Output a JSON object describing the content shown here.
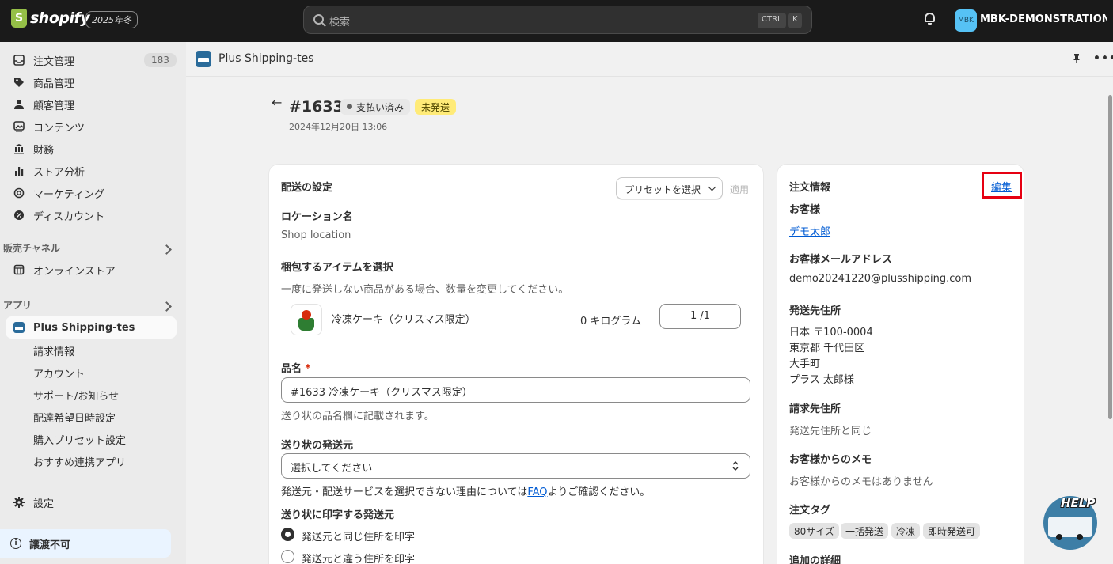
{
  "topbar": {
    "logo_text": "shopify",
    "edition": "2025年冬",
    "search_placeholder": "検索",
    "kbd_ctrl": "CTRL",
    "kbd_k": "K",
    "avatar_initials": "MBK",
    "store_name": "MBK-DEMONSTRATION-..."
  },
  "sidebar": {
    "items": [
      {
        "label": "注文管理",
        "icon": "inbox-icon"
      },
      {
        "label": "商品管理",
        "icon": "tag-icon"
      },
      {
        "label": "顧客管理",
        "icon": "person-icon"
      },
      {
        "label": "コンテンツ",
        "icon": "image-icon"
      },
      {
        "label": "財務",
        "icon": "bank-icon"
      },
      {
        "label": "ストア分析",
        "icon": "bar-chart-icon"
      },
      {
        "label": "マーケティング",
        "icon": "target-icon"
      },
      {
        "label": "ディスカウント",
        "icon": "discount-icon"
      }
    ],
    "orders_count": "183",
    "sales_channels_label": "販売チャネル",
    "online_store": "オンラインストア",
    "apps_label": "アプリ",
    "active_app": "Plus Shipping-tes",
    "sub_items": [
      "請求情報",
      "アカウント",
      "サポート/お知らせ",
      "配達希望日時設定",
      "購入プリセット設定",
      "おすすめ連携アプリ"
    ],
    "settings": "設定",
    "not_transferable": "譲渡不可"
  },
  "app_header": {
    "title": "Plus Shipping-tes",
    "more": "•••"
  },
  "order": {
    "back": "←",
    "number": "#1633",
    "paid_badge": "支払い済み",
    "unshipped_badge": "未発送",
    "date": "2024年12月20日 13:06"
  },
  "shipping": {
    "title": "配送の設定",
    "preset_button": "プリセットを選択",
    "apply": "適用",
    "location_label": "ロケーション名",
    "location_value": "Shop location",
    "items_label": "梱包するアイテムを選択",
    "items_help": "一度に発送しない商品がある場合、数量を変更してください。",
    "product_name": "冷凍ケーキ（クリスマス限定）",
    "product_weight": "0 キログラム",
    "product_qty": "1 /1",
    "item_name_label": "品名",
    "required_mark": "*",
    "item_name_value": "#1633 冷凍ケーキ（クリスマス限定）",
    "item_name_help": "送り状の品名欄に記載されます。",
    "sender_label": "送り状の発送元",
    "sender_placeholder": "選択してください",
    "sender_help_before": "発送元・配送サービスを選択できない理由については",
    "sender_help_link": "FAQ",
    "sender_help_after": "よりご確認ください。",
    "print_label": "送り状に印字する発送元",
    "radio_same": "発送元と同じ住所を印字",
    "radio_other": "発送元と違う住所を印字"
  },
  "order_info": {
    "title": "注文情報",
    "edit": "編集",
    "customer_label": "お客様",
    "customer_name": "デモ太郎",
    "email_label": "お客様メールアドレス",
    "email": "demo20241220@plusshipping.com",
    "ship_address_label": "発送先住所",
    "ship_address_lines": [
      "日本 〒100-0004",
      "東京都 千代田区",
      "大手町",
      "プラス 太郎様"
    ],
    "billing_label": "請求先住所",
    "billing_value": "発送先住所と同じ",
    "memo_label": "お客様からのメモ",
    "memo_value": "お客様からのメモはありません",
    "tags_label": "注文タグ",
    "tags": [
      "80サイズ",
      "一括発送",
      "冷凍",
      "即時発送可"
    ],
    "more_label": "追加の詳細"
  },
  "help_widget": {
    "label": "HELP"
  },
  "colors": {
    "accent_link": "#005bd3",
    "edit_highlight": "#e60012",
    "unshipped_badge": "#ffeb78"
  }
}
